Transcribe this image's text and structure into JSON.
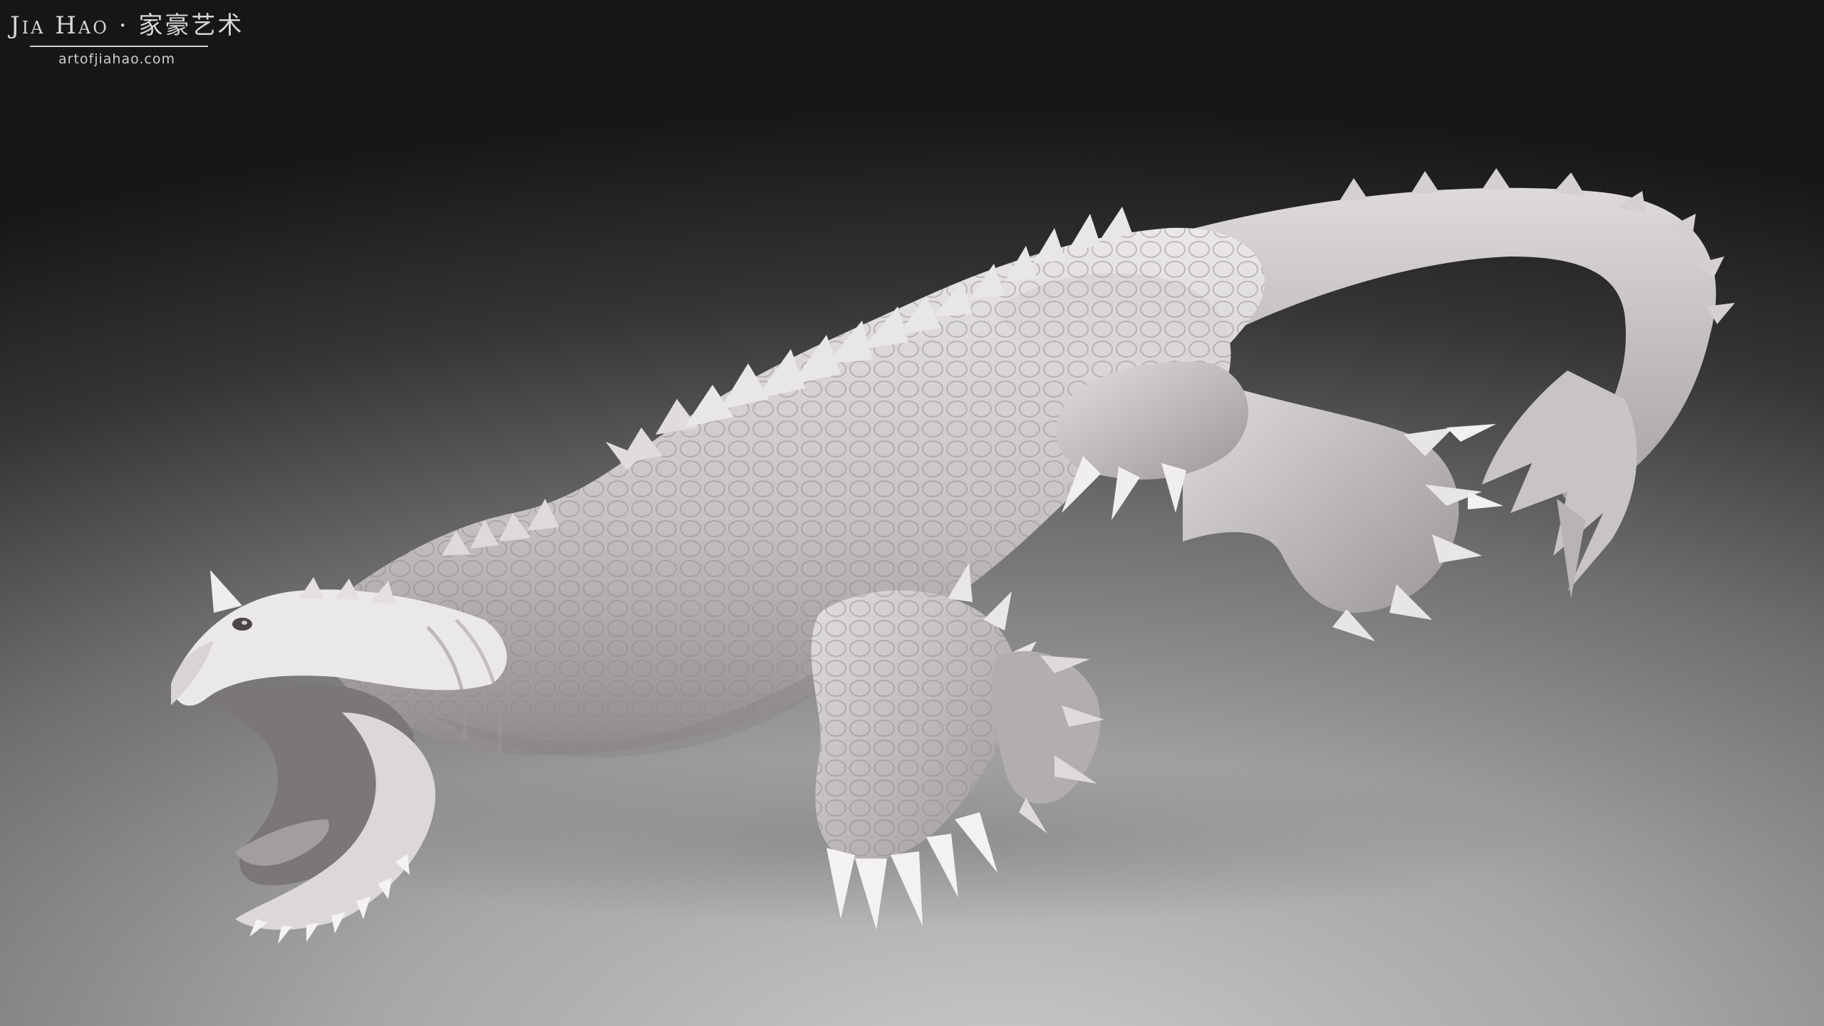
{
  "watermark": {
    "name": "Jia Hao · 家豪艺术",
    "url": "artofjiahao.com"
  },
  "colors": {
    "sculpt_light": "#e6e3e4",
    "sculpt_mid": "#b9b5b6",
    "sculpt_shadow": "#807b7c",
    "text": "#d7d7d7"
  }
}
